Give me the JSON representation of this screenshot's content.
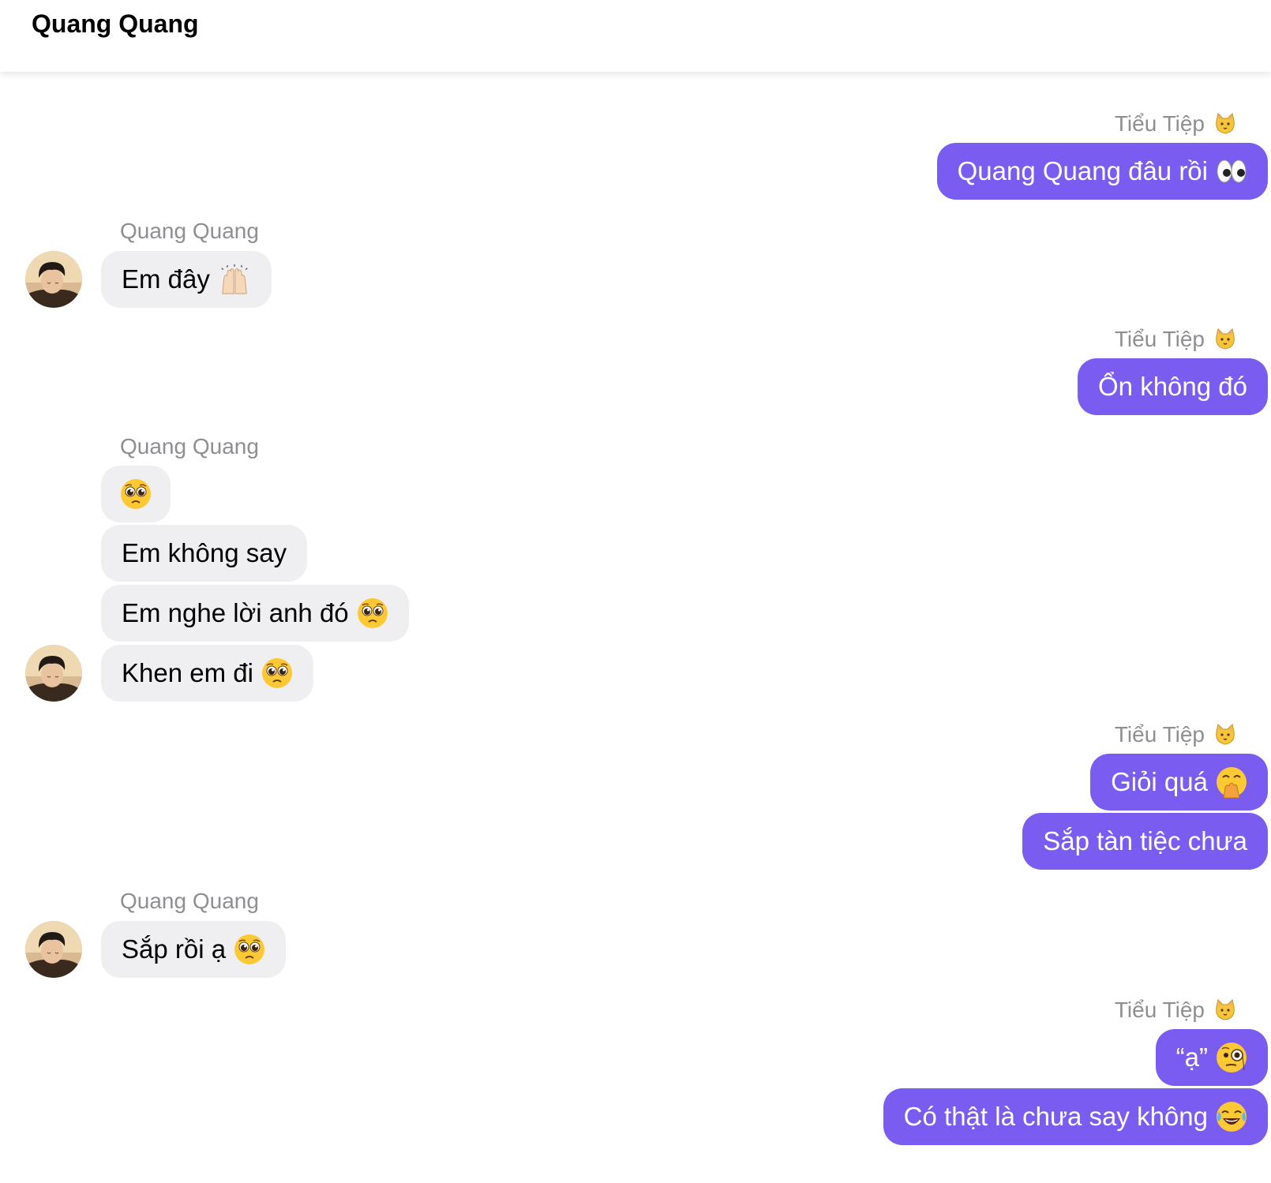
{
  "header": {
    "title": "Quang Quang"
  },
  "colors": {
    "outgoing_bubble": "#7b5cf0",
    "incoming_bubble": "#efeff2",
    "sender_name": "#8e8e93"
  },
  "messages": [
    {
      "sender": "Tiểu Tiệp",
      "sender_icon": "cat-face-icon",
      "text": "Quang Quang đâu rồi",
      "emoji": "eyes-icon",
      "direction": "outgoing"
    },
    {
      "sender": "Quang Quang",
      "text": "Em đây",
      "emoji": "raising-hands-icon",
      "direction": "incoming"
    },
    {
      "sender": "Tiểu Tiệp",
      "sender_icon": "cat-face-icon",
      "text": "Ổn không đó",
      "direction": "outgoing"
    },
    {
      "sender": "Quang Quang",
      "text": "",
      "emoji": "pleading-face-icon",
      "direction": "incoming"
    },
    {
      "text": "Em không say",
      "direction": "incoming"
    },
    {
      "text": "Em nghe lời anh đó",
      "emoji": "pleading-face-icon",
      "direction": "incoming"
    },
    {
      "text": "Khen em đi",
      "emoji": "pleading-face-icon",
      "direction": "incoming"
    },
    {
      "sender": "Tiểu Tiệp",
      "sender_icon": "cat-face-icon",
      "text": "Giỏi quá",
      "emoji": "hand-over-mouth-icon",
      "direction": "outgoing"
    },
    {
      "text": "Sắp tàn tiệc chưa",
      "direction": "outgoing"
    },
    {
      "sender": "Quang Quang",
      "text": "Sắp rồi ạ",
      "emoji": "pleading-face-icon",
      "direction": "incoming"
    },
    {
      "sender": "Tiểu Tiệp",
      "sender_icon": "cat-face-icon",
      "text": "“ạ”",
      "emoji": "monocle-face-icon",
      "direction": "outgoing"
    },
    {
      "text": "Có thật là chưa say không",
      "emoji": "tears-of-joy-icon",
      "direction": "outgoing"
    }
  ]
}
